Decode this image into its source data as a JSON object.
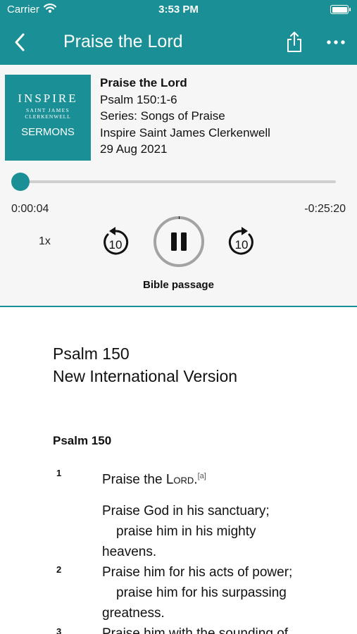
{
  "status": {
    "carrier": "Carrier",
    "time": "3:53 PM"
  },
  "nav": {
    "title": "Praise the Lord"
  },
  "artwork": {
    "line1": "INSPIRE",
    "line2": "SAINT JAMES",
    "line3": "CLERKENWELL",
    "line4": "SERMONS"
  },
  "sermon": {
    "title": "Praise the Lord",
    "passage": "Psalm 150:1-6",
    "series": "Series: Songs of Praise",
    "church": "Inspire Saint James Clerkenwell",
    "date": "29 Aug 2021"
  },
  "player": {
    "elapsed": "0:00:04",
    "remaining": "-0:25:20",
    "speed": "1x",
    "skip_back_seconds": "10",
    "skip_forward_seconds": "10",
    "progress_fraction": 0.003,
    "bible_passage_label": "Bible passage"
  },
  "passage": {
    "reference": "Psalm 150",
    "version": "New International Version",
    "heading": "Psalm 150",
    "verse1_number": "1",
    "verse1_line1_pre": "Praise the ",
    "verse1_line1_lord": "Lord",
    "verse1_line1_post": ".",
    "verse1_footnote": "[a]",
    "verse1_line2": "Praise God in his sanctuary;",
    "verse1_line3": "praise him in his mighty",
    "verse1_line4": "heavens.",
    "verse2_number": "2",
    "verse2_line1": "Praise him for his acts of power;",
    "verse2_line2": "praise him for his surpassing",
    "verse2_line3": "greatness.",
    "verse3_number": "3",
    "verse3_line1": "Praise him with the sounding of"
  },
  "colors": {
    "accent": "#1a8f96",
    "background": "#f6f6f6",
    "passage_background": "#ffffff"
  },
  "icons": [
    "wifi-icon",
    "battery-icon",
    "back-chevron-icon",
    "share-icon",
    "more-icon",
    "skip-back-icon",
    "pause-icon",
    "skip-forward-icon"
  ]
}
